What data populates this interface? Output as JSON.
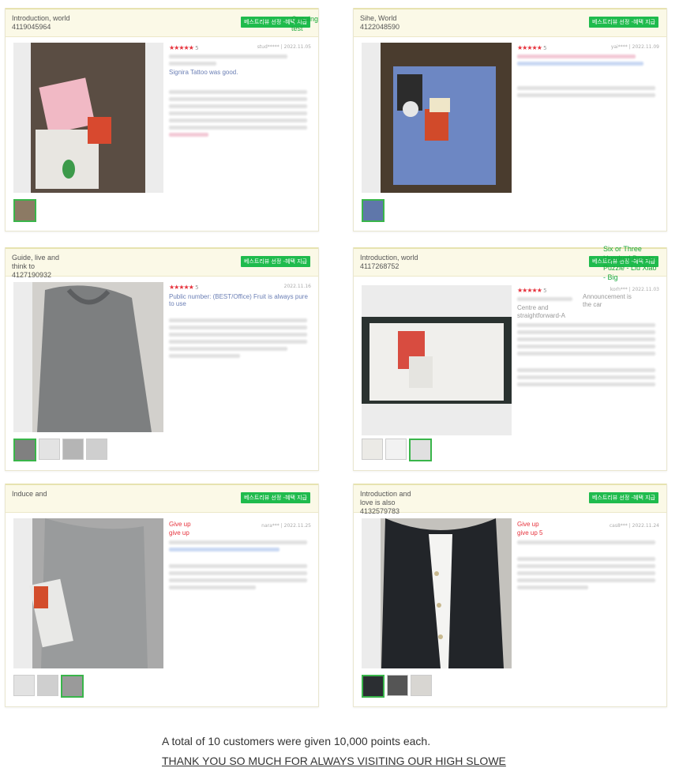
{
  "badge_label": "베스트리뷰 선정 -혜택 지급",
  "cards": [
    {
      "header": "Introduction, world 4119045964",
      "overlay": "Queuing test",
      "rating": "5",
      "stars": "★★★★★",
      "user": "stud*****",
      "date": "2022.11.05",
      "review_line": "Signira Tattoo was good."
    },
    {
      "header": "Sihe, World 4122048590",
      "rating": "5",
      "stars": "★★★★★",
      "user": "yai****",
      "date": "2022.11.09"
    },
    {
      "header": "Guide, live and think to 4127190932",
      "rating": "5",
      "stars": "★★★★★",
      "public_number": "Public number: (BEST/Office) Fruit is always pure to use",
      "date": "2022.11.16"
    },
    {
      "header": "Introduction, world 4117268752",
      "overlay": "Six or Three Hundred Beasts - Puzzle - Liu Xiao - Big",
      "announcement": "Announcement is the car",
      "centre": "Centre and straightforward-A",
      "rating": "5",
      "stars": "★★★★★",
      "user": "korh***",
      "date": "2022.11.03"
    },
    {
      "header": "Induce and",
      "red_label": "Give up give up",
      "user": "nara***",
      "date": "2022.11.25"
    },
    {
      "header": "Introduction and love is also 4132579783",
      "red_label": "Give up give up 5",
      "user": "cas8***",
      "date": "2022.11.24"
    }
  ],
  "footer": {
    "line1": "A total of 10 customers were given 10,000 points each.",
    "line2": "THANK YOU SO MUCH FOR ALWAYS VISITING OUR HIGH SLOWE"
  }
}
